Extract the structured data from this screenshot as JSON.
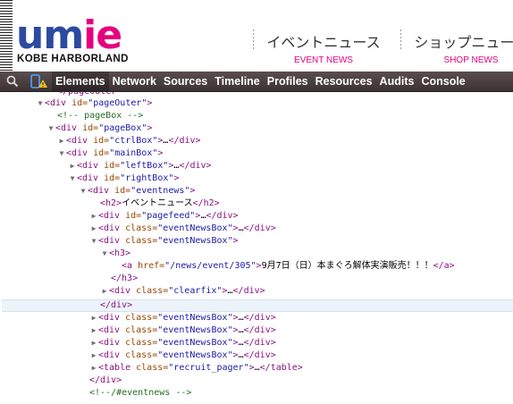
{
  "site": {
    "logo_part1": "um",
    "logo_part2": "ie",
    "logo_sub": "KOBE HARBORLAND",
    "nav": [
      {
        "jp": "イベントニュース",
        "en": "EVENT NEWS"
      },
      {
        "jp": "ショップニュース",
        "en": "SHOP NEWS"
      }
    ]
  },
  "devtools": {
    "tabs": [
      "Elements",
      "Network",
      "Sources",
      "Timeline",
      "Profiles",
      "Resources",
      "Audits",
      "Console"
    ],
    "active_tab": "Elements"
  },
  "tree": {
    "rows": [
      {
        "tri": "",
        "tag_open": "</",
        "tag": "pageOuter",
        "rest": ""
      },
      {
        "tri": "▼",
        "html": "div id=\"pageOuter\""
      }
    ],
    "r0": "</ pageOuter",
    "r1_tag": "<div",
    "r1_attr": " id=",
    "r1_val": "\"pageOuter\"",
    "r1_end": ">",
    "r2": "<!-- pageBox -->",
    "r3_val": "\"pageBox\"",
    "r4_val": "\"ctrlBox\"",
    "r5_val": "\"mainBox\"",
    "r6_val": "\"leftBox\"",
    "r7_val": "\"rightBox\"",
    "r8_val": "\"eventnews\"",
    "r9_text": "イベントニュース",
    "r10_val": "\"pagefeed\"",
    "r11_val": "\"eventNewsBox\"",
    "r12_val": "\"eventNewsBox\"",
    "r14_val": "\"/news/event/305\"",
    "r14_text": "9月7日（日）本まぐろ解体実演販売！！！",
    "r16_val": "\"clearfix\"",
    "r18_val": "\"eventNewsBox\"",
    "r19_val": "\"eventNewsBox\"",
    "r20_val": "\"eventNewsBox\"",
    "r21_val": "\"eventNewsBox\"",
    "r22_val": "\"recruit_pager\"",
    "r24": "<!--/#eventnews -->",
    "ellipsis": "…"
  }
}
